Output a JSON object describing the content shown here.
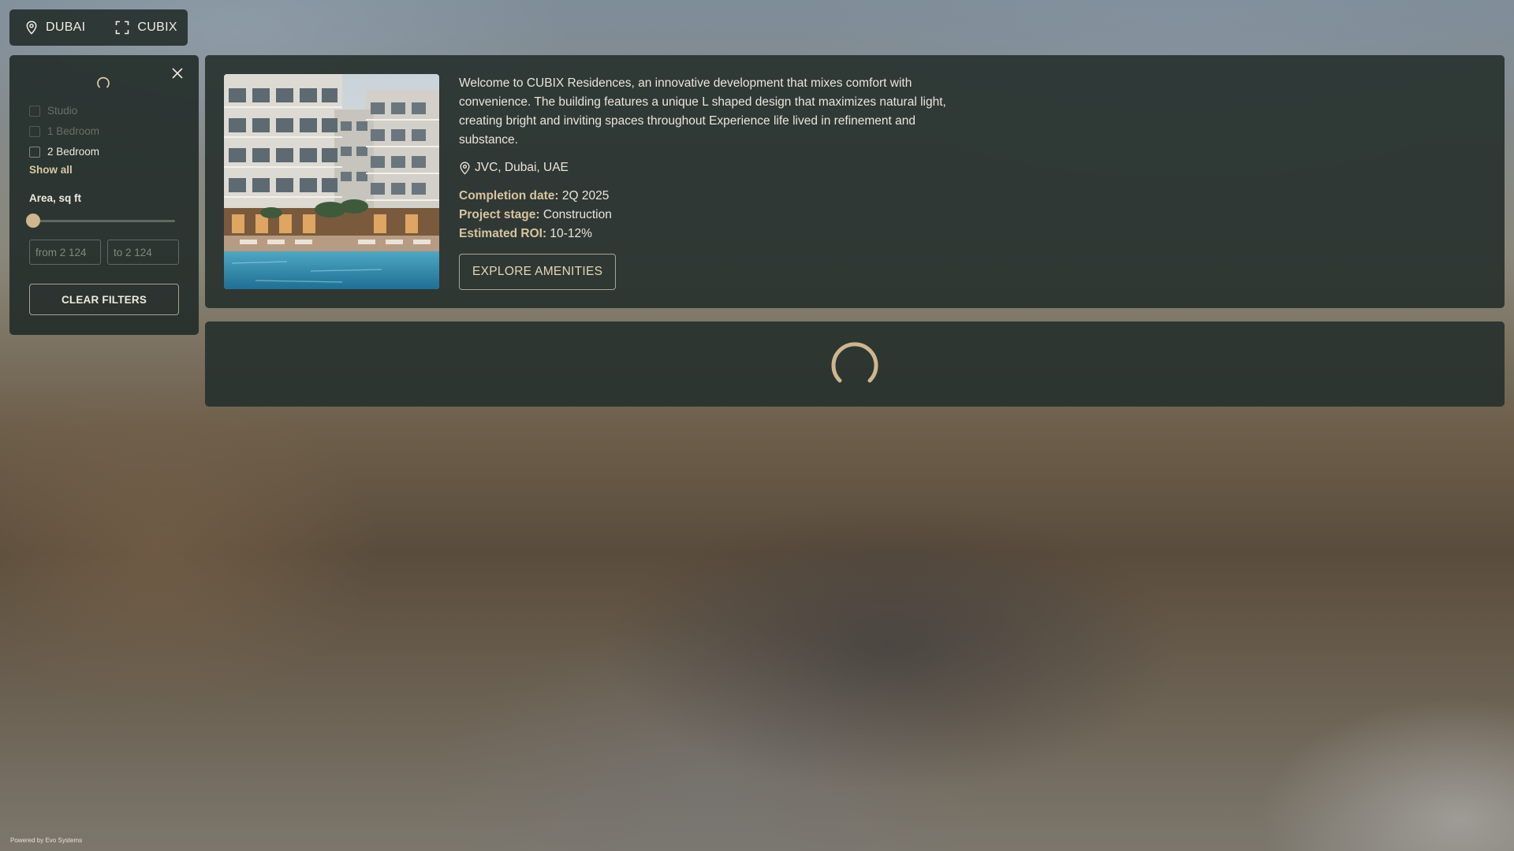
{
  "breadcrumb": {
    "city": "DUBAI",
    "project": "CUBIX"
  },
  "filters": {
    "unit_types": [
      {
        "label": "Studio",
        "enabled": false
      },
      {
        "label": "1 Bedroom",
        "enabled": false
      },
      {
        "label": "2 Bedroom",
        "enabled": true
      }
    ],
    "show_all": "Show all",
    "area_label": "Area, sq ft",
    "from_placeholder": "from 2 124",
    "to_placeholder": "to 2 124",
    "clear_label": "CLEAR FILTERS"
  },
  "project": {
    "description": "Welcome to CUBIX Residences, an innovative development that mixes comfort with convenience. The building features a unique L shaped design that maximizes natural light, creating bright and inviting spaces throughout Experience life lived in refinement and substance.",
    "location": "JVC, Dubai, UAE",
    "completion_label": "Completion date:",
    "completion_value": "2Q 2025",
    "stage_label": "Project stage:",
    "stage_value": "Construction",
    "roi_label": "Estimated ROI:",
    "roi_value": "10-12%",
    "explore_label": "EXPLORE AMENITIES"
  },
  "footer": "Powered by Evo Systems",
  "colors": {
    "accent": "#cfb590",
    "panel": "#26302c"
  },
  "icons": [
    "map-pin-icon",
    "fullscreen-icon",
    "close-icon",
    "spinner-icon"
  ]
}
